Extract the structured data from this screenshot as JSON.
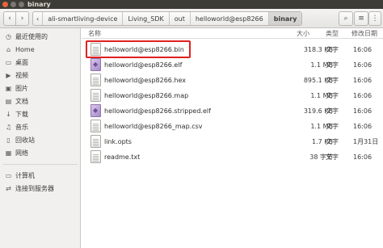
{
  "window": {
    "title": "binary"
  },
  "toolbar": {
    "back_icon": "‹",
    "forward_icon": "›",
    "crumb_nav_left": "‹",
    "breadcrumbs": [
      "ali-smartliving-device",
      "Living_SDK",
      "out",
      "helloworld@esp8266",
      "binary"
    ],
    "search_icon": "⌕",
    "list_icon": "≡",
    "menu_icon": "⋮"
  },
  "sidebar": {
    "items": [
      {
        "label": "最近使用的",
        "icon": "◷"
      },
      {
        "label": "Home",
        "icon": "⌂"
      },
      {
        "label": "桌面",
        "icon": "▭"
      },
      {
        "label": "视频",
        "icon": "▶"
      },
      {
        "label": "图片",
        "icon": "▣"
      },
      {
        "label": "文档",
        "icon": "▤"
      },
      {
        "label": "下载",
        "icon": "↓"
      },
      {
        "label": "音乐",
        "icon": "♫"
      },
      {
        "label": "回收站",
        "icon": "▯"
      },
      {
        "label": "网络",
        "icon": "▦"
      },
      {
        "label": "计算机",
        "icon": "▭"
      },
      {
        "label": "连接到服务器",
        "icon": "⇄"
      }
    ]
  },
  "columns": {
    "name": "名称",
    "size": "大小",
    "type": "类型",
    "modified": "修改日期"
  },
  "files": [
    {
      "name": "helloworld@esp8266.bin",
      "size": "318.3 KB",
      "type": "文字",
      "modified": "16:06",
      "kind": "text"
    },
    {
      "name": "helloworld@esp8266.elf",
      "size": "1.1 MB",
      "type": "文字",
      "modified": "16:06",
      "kind": "elf"
    },
    {
      "name": "helloworld@esp8266.hex",
      "size": "895.1 KB",
      "type": "文字",
      "modified": "16:06",
      "kind": "text"
    },
    {
      "name": "helloworld@esp8266.map",
      "size": "1.1 MB",
      "type": "文字",
      "modified": "16:06",
      "kind": "text"
    },
    {
      "name": "helloworld@esp8266.stripped.elf",
      "size": "319.6 KB",
      "type": "文字",
      "modified": "16:06",
      "kind": "elf"
    },
    {
      "name": "helloworld@esp8266_map.csv",
      "size": "1.1 MB",
      "type": "文字",
      "modified": "16:06",
      "kind": "text"
    },
    {
      "name": "link.opts",
      "size": "1.7 KB",
      "type": "文字",
      "modified": "1月31日",
      "kind": "text"
    },
    {
      "name": "readme.txt",
      "size": "38 字节",
      "type": "文字",
      "modified": "16:06",
      "kind": "text"
    }
  ],
  "colors": {
    "highlight": "#e02020",
    "titlebar": "#3d3c37",
    "close": "#e9633d"
  }
}
